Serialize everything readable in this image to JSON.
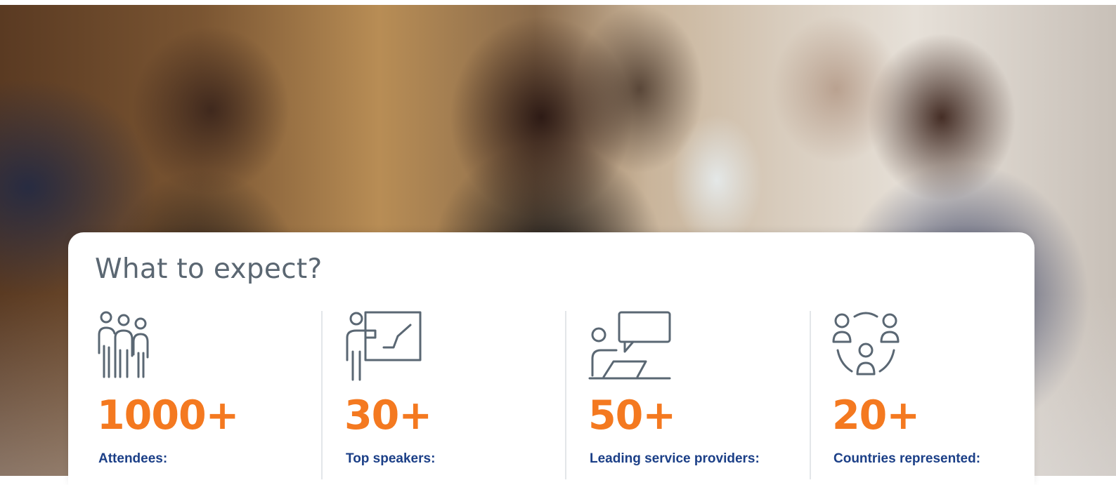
{
  "section": {
    "title": "What to expect?"
  },
  "stats": [
    {
      "value": "1000+",
      "label": "Attendees:",
      "icon": "people-group-icon"
    },
    {
      "value": "30+",
      "label": "Top speakers:",
      "icon": "presenter-board-icon"
    },
    {
      "value": "50+",
      "label": "Leading service providers:",
      "icon": "speech-bubble-laptop-icon"
    },
    {
      "value": "20+",
      "label": "Countries represented:",
      "icon": "network-people-icon"
    }
  ],
  "colors": {
    "accent": "#f47920",
    "label": "#1b3f87",
    "title": "#5b6772",
    "icon": "#5a6773",
    "divider": "#e3e6e9"
  }
}
